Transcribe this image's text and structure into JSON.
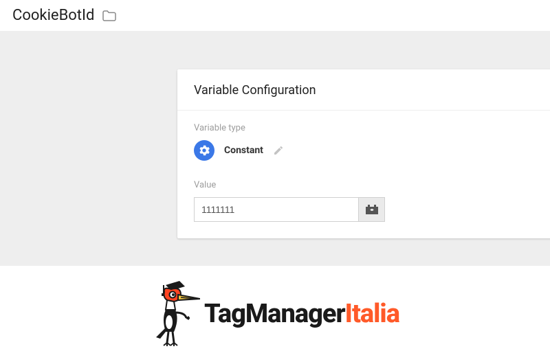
{
  "header": {
    "title": "CookieBotId"
  },
  "card": {
    "title": "Variable Configuration",
    "type_label": "Variable type",
    "type_name": "Constant",
    "value_label": "Value",
    "value": "1111111"
  },
  "logo": {
    "part1": "TagManager",
    "part2": "Italia"
  }
}
